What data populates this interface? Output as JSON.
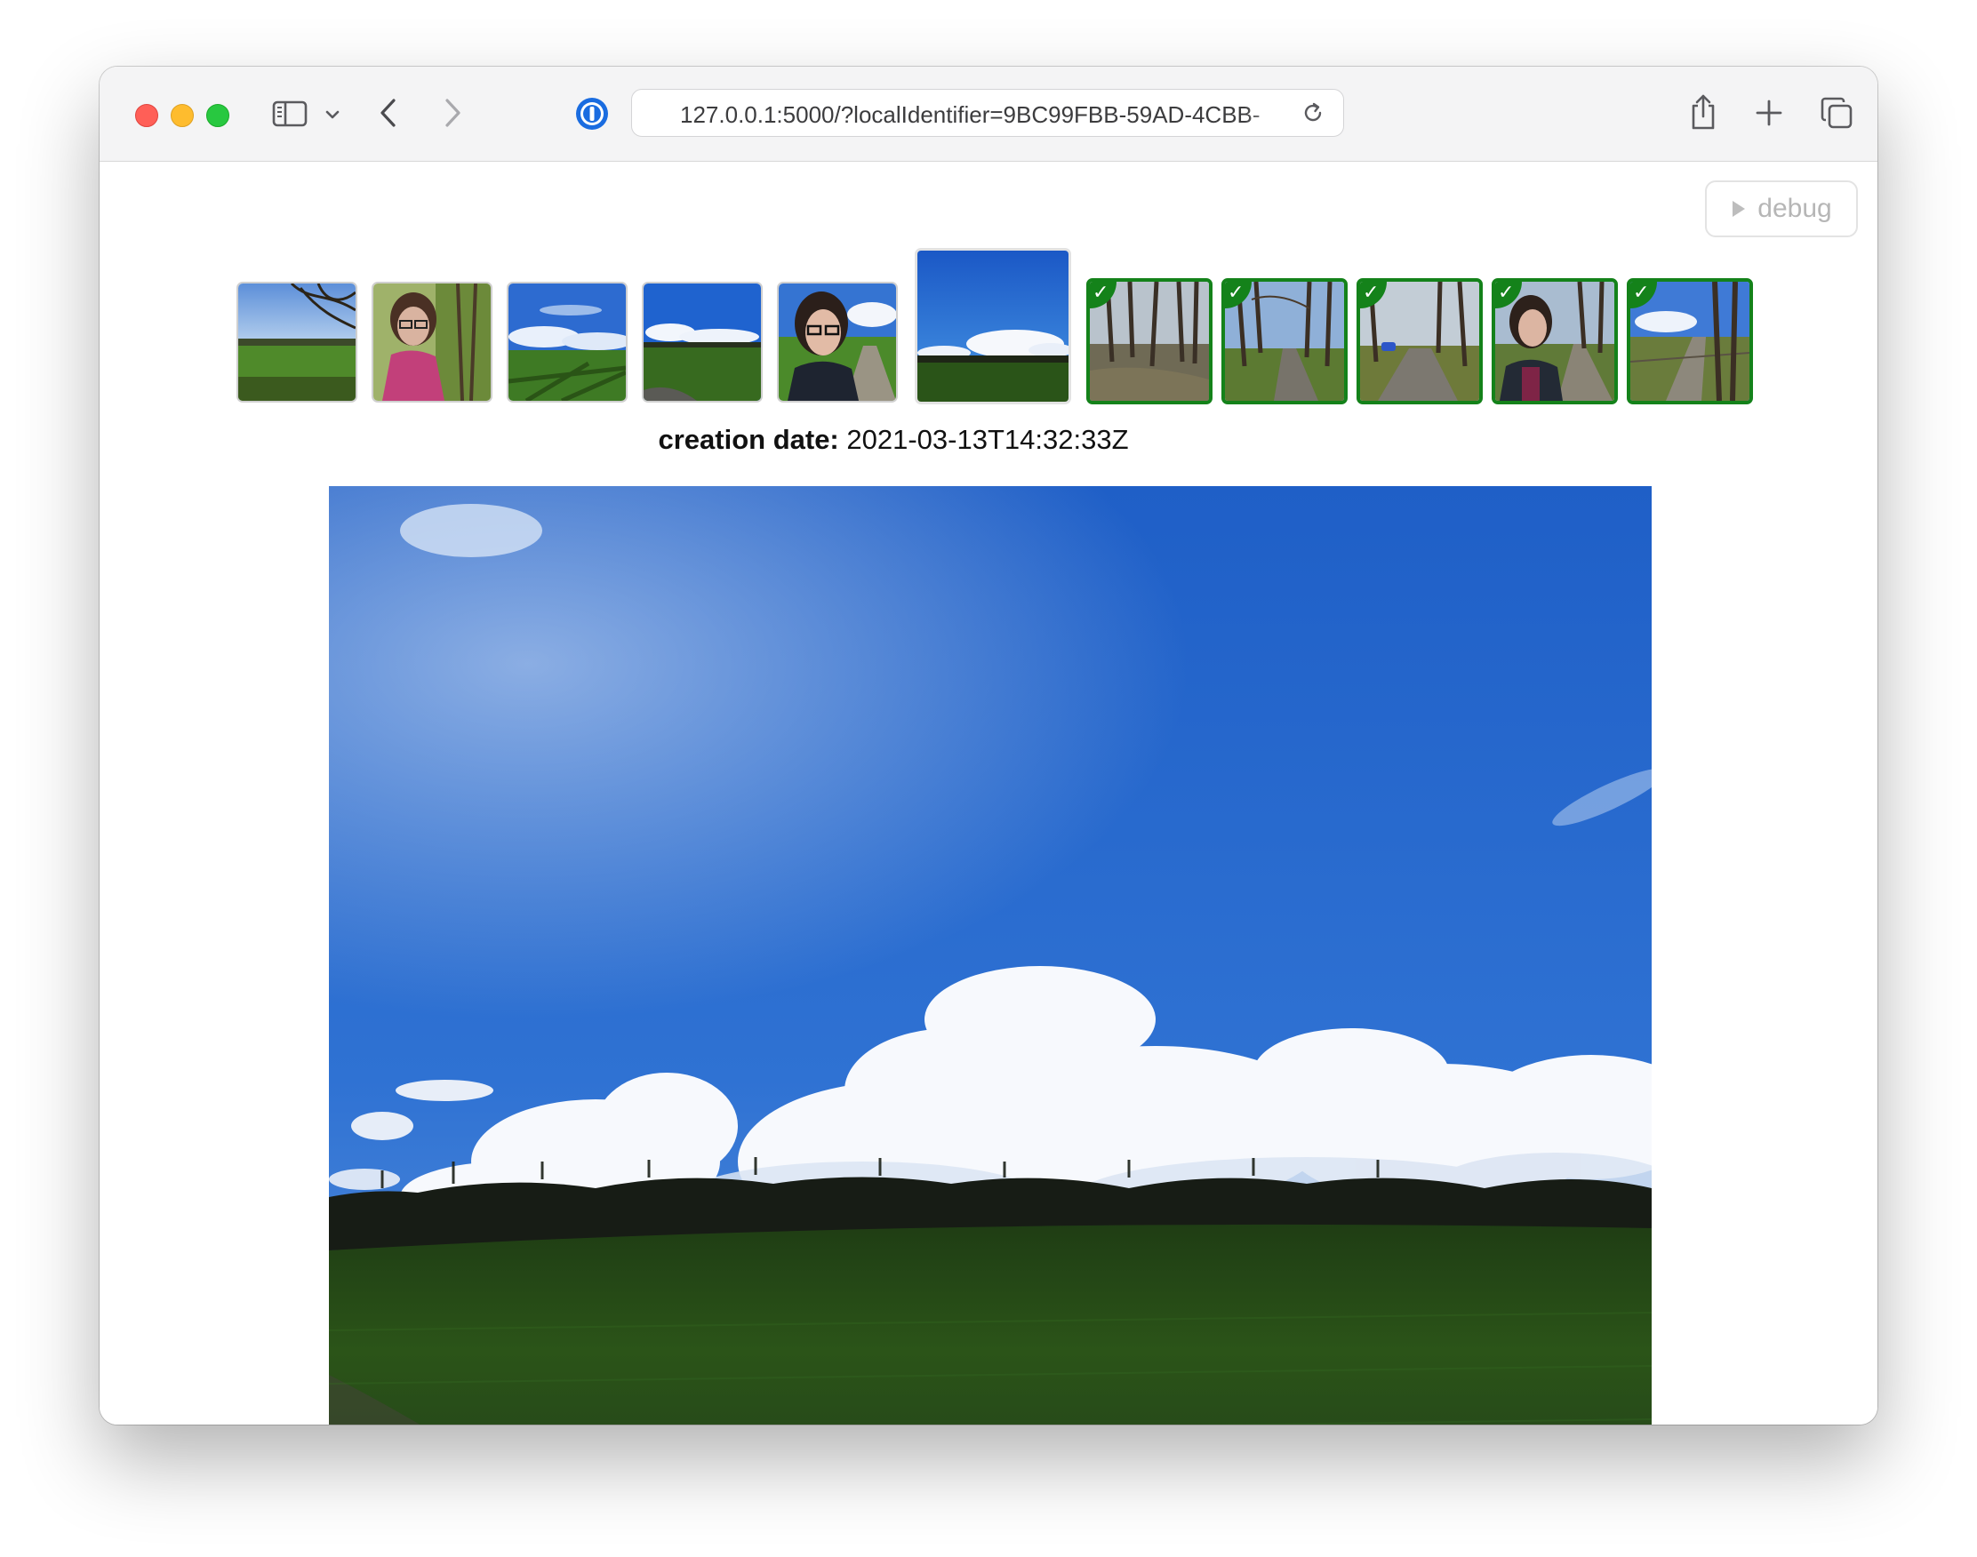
{
  "browser": {
    "url": "127.0.0.1:5000/?localIdentifier=9BC99FBB-59AD-4CBB-",
    "icons": {
      "sidebar": "sidebar-icon",
      "chevron": "chevron-down-icon",
      "back": "back-arrow-icon",
      "forward": "forward-arrow-icon",
      "password": "password-manager-icon",
      "reload": "reload-icon",
      "share": "share-icon",
      "new_tab": "plus-icon",
      "tabs": "tab-overview-icon"
    }
  },
  "debug": {
    "label": "debug",
    "icon": "play-triangle-icon"
  },
  "thumbnails": [
    {
      "scene": "meadow-with-tree",
      "checked": false
    },
    {
      "scene": "selfie-pink-scarf",
      "checked": false
    },
    {
      "scene": "sky-field-shadows",
      "checked": false
    },
    {
      "scene": "blue-sky-green-field",
      "checked": false
    },
    {
      "scene": "selfie-field",
      "checked": false
    },
    {
      "scene": "sky-clouds-field",
      "checked": false,
      "current": true
    },
    {
      "scene": "woodland-path",
      "checked": true
    },
    {
      "scene": "woodland-lane",
      "checked": true
    },
    {
      "scene": "woodland-lane-car",
      "checked": true
    },
    {
      "scene": "selfie-woodland-lane",
      "checked": true
    },
    {
      "scene": "fenced-woodland-lane",
      "checked": true
    }
  ],
  "photo": {
    "creation_label": "creation date:",
    "creation_value": "2021-03-13T14:32:33Z",
    "scene": "blue-sky-clouds-treeline-green-field"
  },
  "colors": {
    "check_green": "#14821a",
    "sky_blue": "#2c6fd1",
    "field_green": "#244d16"
  }
}
